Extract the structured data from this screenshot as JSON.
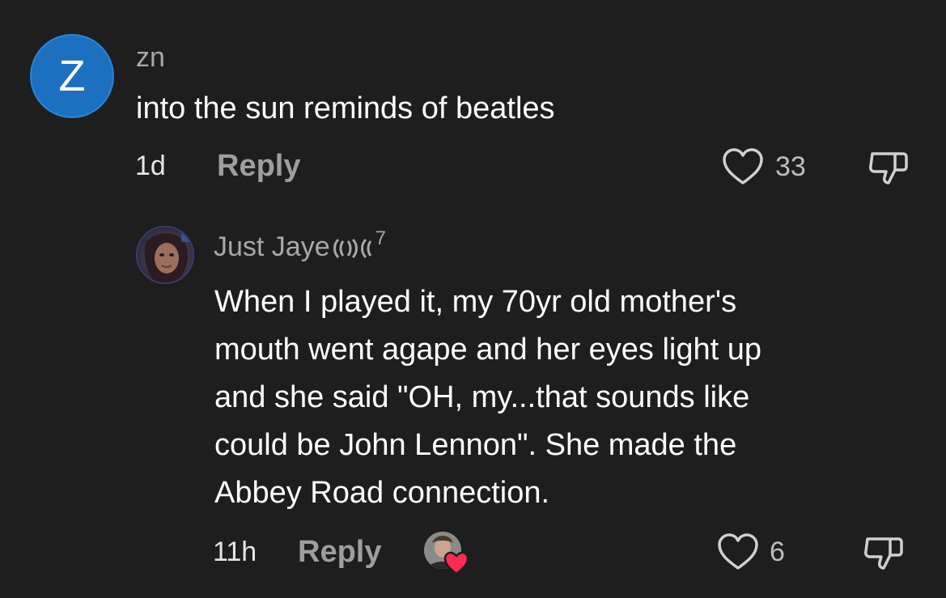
{
  "comment": {
    "avatar_letter": "Z",
    "username": "zn",
    "text": "into the sun reminds of beatles",
    "time": "1d",
    "reply_label": "Reply",
    "likes": "33"
  },
  "reply": {
    "username": "Just Jaye",
    "username_suffix": "7",
    "text_lines": [
      "When I played it, my 70yr old mother's",
      "mouth went agape and her eyes light up",
      "and she said \"OH, my...that sounds like",
      "could be John Lennon\". She made the",
      "Abbey Road connection."
    ],
    "time": "11h",
    "reply_label": "Reply",
    "likes": "6"
  },
  "colors": {
    "background": "#1e1e1e",
    "avatar_blue": "#1d6fc0",
    "heart_red": "#fe2c55"
  }
}
